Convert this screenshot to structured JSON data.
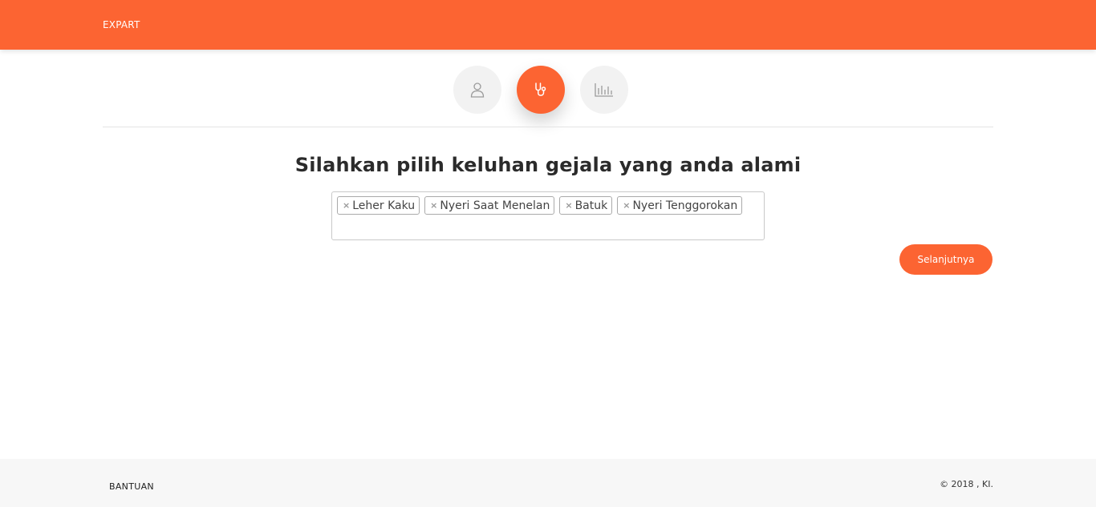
{
  "header": {
    "brand": "EXPART",
    "accent_color": "#fc6432"
  },
  "steps": [
    {
      "icon": "user-icon",
      "active": false
    },
    {
      "icon": "stethoscope-icon",
      "active": true
    },
    {
      "icon": "bar-chart-icon",
      "active": false
    }
  ],
  "main": {
    "heading": "Silahkan pilih keluhan gejala yang anda alami",
    "selected_symptoms": [
      {
        "remove": "×",
        "label": "Leher Kaku"
      },
      {
        "remove": "×",
        "label": "Nyeri Saat Menelan"
      },
      {
        "remove": "×",
        "label": "Batuk"
      },
      {
        "remove": "×",
        "label": "Nyeri Tenggorokan"
      }
    ],
    "next_label": "Selanjutnya"
  },
  "footer": {
    "help_label": "BANTUAN",
    "copyright": "© 2018 , KI."
  }
}
